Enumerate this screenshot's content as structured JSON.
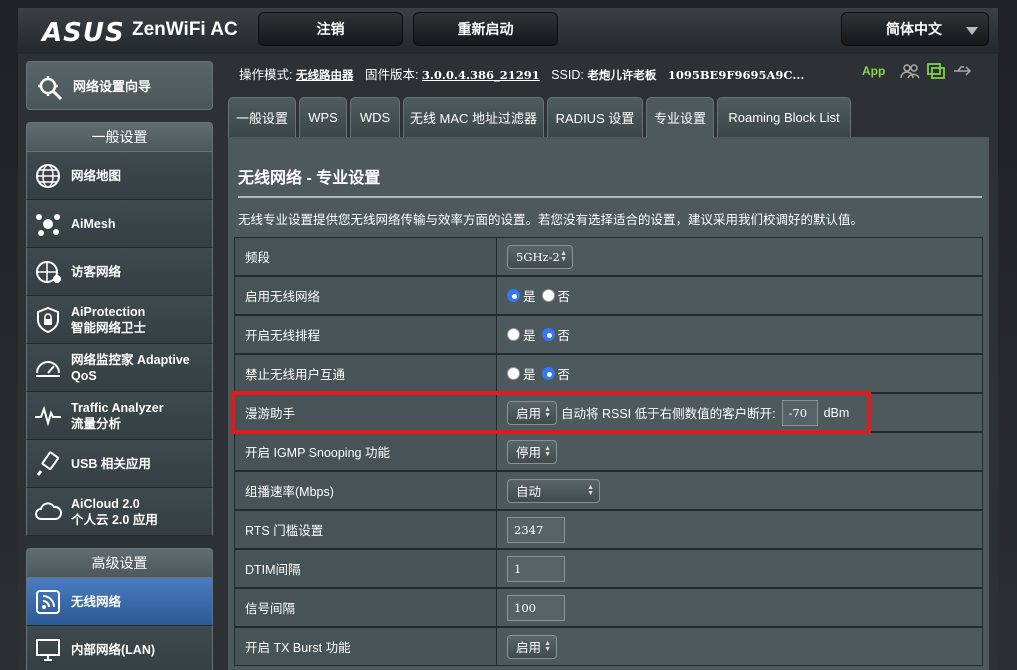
{
  "header": {
    "logo": "ASUS",
    "model": "ZenWiFi AC",
    "logout_label": "注销",
    "reboot_label": "重新启动",
    "language": "简体中文"
  },
  "sidebar": {
    "qis_label": "网络设置向导",
    "general_title": "一般设置",
    "general_items": [
      {
        "line1": "网络地图",
        "line2": ""
      },
      {
        "line1": "AiMesh",
        "line2": ""
      },
      {
        "line1": "访客网络",
        "line2": ""
      },
      {
        "line1": "AiProtection",
        "line2": "智能网络卫士"
      },
      {
        "line1": "网络监控家 Adaptive",
        "line2": "QoS"
      },
      {
        "line1": "Traffic Analyzer",
        "line2": "流量分析"
      },
      {
        "line1": "USB 相关应用",
        "line2": ""
      },
      {
        "line1": "AiCloud 2.0",
        "line2": "个人云 2.0 应用"
      }
    ],
    "advanced_title": "高级设置",
    "advanced_items": [
      {
        "line1": "无线网络",
        "line2": ""
      },
      {
        "line1": "内部网络(LAN)",
        "line2": ""
      }
    ]
  },
  "status": {
    "mode_label": "操作模式:",
    "mode_value": "无线路由器",
    "firmware_label": "固件版本:",
    "firmware_value": "3.0.0.4.386_21291",
    "ssid_label": "SSID:",
    "ssid_value": "老炮儿许老板",
    "ssid2_value": "1095BE9F9695A9C...",
    "app_label": "App"
  },
  "tabs": [
    "一般设置",
    "WPS",
    "WDS",
    "无线 MAC 地址过滤器",
    "RADIUS 设置",
    "专业设置",
    "Roaming Block List"
  ],
  "content": {
    "title": "无线网络 - 专业设置",
    "description": "无线专业设置提供您无线网络传输与效率方面的设置。若您没有选择适合的设置，建议采用我们校调好的默认值。",
    "yes": "是",
    "no": "否",
    "rows": {
      "band": {
        "label": "频段",
        "value": "5GHz-2"
      },
      "enable_radio": {
        "label": "启用无线网络"
      },
      "schedule": {
        "label": "开启无线排程"
      },
      "ap_isolate": {
        "label": "禁止无线用户互通"
      },
      "roaming": {
        "label": "漫游助手",
        "value": "启用",
        "text": "自动将 RSSI 低于右侧数值的客户断开:",
        "rssi": "-70",
        "unit": "dBm"
      },
      "igmp": {
        "label": "开启 IGMP Snooping 功能",
        "value": "停用"
      },
      "multicast": {
        "label": "组播速率(Mbps)",
        "value": "自动"
      },
      "rts": {
        "label": "RTS 门槛设置",
        "value": "2347"
      },
      "dtim": {
        "label": "DTIM间隔",
        "value": "1"
      },
      "beacon": {
        "label": "信号间隔",
        "value": "100"
      },
      "txburst": {
        "label": "开启 TX Burst 功能",
        "value": "启用"
      }
    }
  }
}
